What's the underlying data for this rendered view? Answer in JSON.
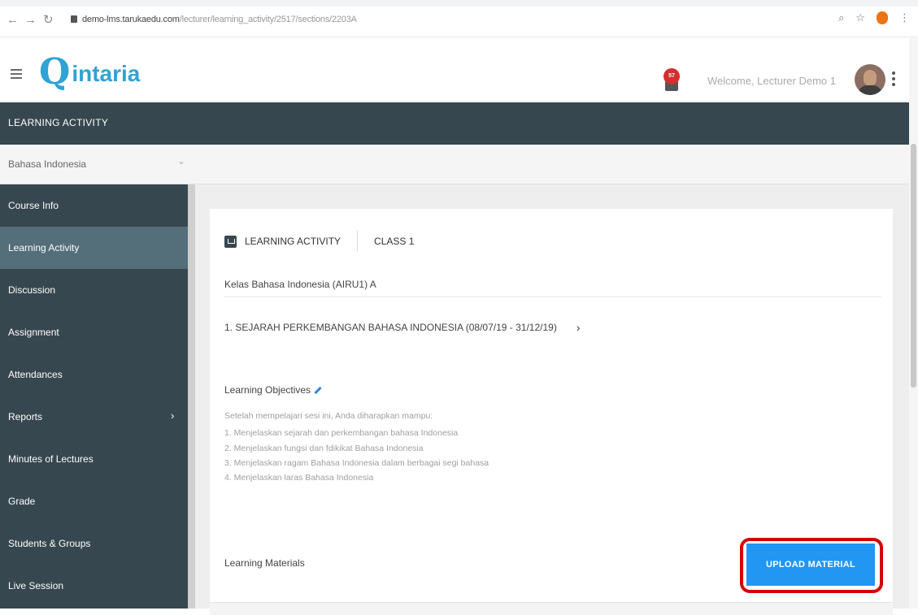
{
  "browser": {
    "url_host": "demo-lms.tarukaedu.com",
    "url_path": "/lecturer/learning_activity/2517/sections/2203A"
  },
  "header": {
    "logo_mark": "Q",
    "logo_word": "intaria",
    "notification_count": "57",
    "welcome_text": "Welcome, Lecturer Demo 1"
  },
  "section_bar": {
    "title": "LEARNING ACTIVITY"
  },
  "subject": {
    "selected": "Bahasa Indonesia"
  },
  "sidebar": {
    "items": [
      {
        "label": "Course Info"
      },
      {
        "label": "Learning Activity"
      },
      {
        "label": "Discussion"
      },
      {
        "label": "Assignment"
      },
      {
        "label": "Attendances"
      },
      {
        "label": "Reports"
      },
      {
        "label": "Minutes of Lectures"
      },
      {
        "label": "Grade"
      },
      {
        "label": "Students & Groups"
      },
      {
        "label": "Live Session"
      }
    ]
  },
  "content": {
    "breadcrumb_section": "LEARNING ACTIVITY",
    "breadcrumb_class": "CLASS 1",
    "class_name": "Kelas Bahasa Indonesia (AIRU1) A",
    "topic": "1. SEJARAH PERKEMBANGAN BAHASA INDONESIA (08/07/19 - 31/12/19)",
    "learning_objectives_title": "Learning Objectives",
    "objectives": [
      "Setelah mempelajari sesi ini, Anda diharapkan mampu:",
      "1. Menjelaskan sejarah dan perkembangan bahasa Indonesia",
      "2. Menjelaskan fungsi dan fdikikat Bahasa Indonesia",
      "3. Menjelaskan ragam Bahasa Indonesia dalam berbagai segi bahasa",
      "4. Menjelaskan laras Bahasa Indonesia"
    ],
    "learning_materials_title": "Learning Materials",
    "upload_button": "UPLOAD MATERIAL"
  }
}
